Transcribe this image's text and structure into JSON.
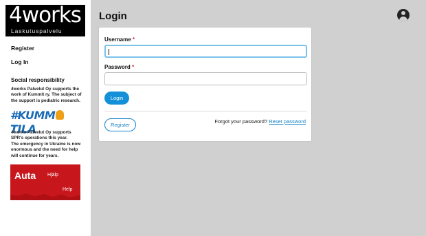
{
  "logo": {
    "brand_4": "4",
    "brand_rest": "works",
    "subtitle": "Laskutuspalvelu"
  },
  "nav": {
    "register": "Register",
    "login": "Log In"
  },
  "social": {
    "heading": "Social responsibility",
    "text1": "4works Palvelut Oy supports the work of Kummit ry. The subject of the support is pediatric research.",
    "kummitila_a": "#KUMM",
    "kummitila_b": "TILA",
    "text2": "4works Palvelut Oy supports SPR's operations this year.",
    "text3": "The emergency in Ukraine is now enormous and the need for help will continue for years.",
    "auta_fi": "Auta",
    "auta_sv": "Hjälp",
    "auta_en": "Help"
  },
  "page": {
    "title": "Login"
  },
  "form": {
    "username_label": "Username",
    "password_label": "Password",
    "required_mark": "*",
    "username_value": "",
    "password_value": "",
    "login_button": "Login",
    "register_button": "Register",
    "forgot_text": "Forgot your password?",
    "reset_link": "Reset password"
  },
  "colors": {
    "accent": "#1390d8",
    "required": "#d9233a",
    "background": "#d0d0d0"
  }
}
